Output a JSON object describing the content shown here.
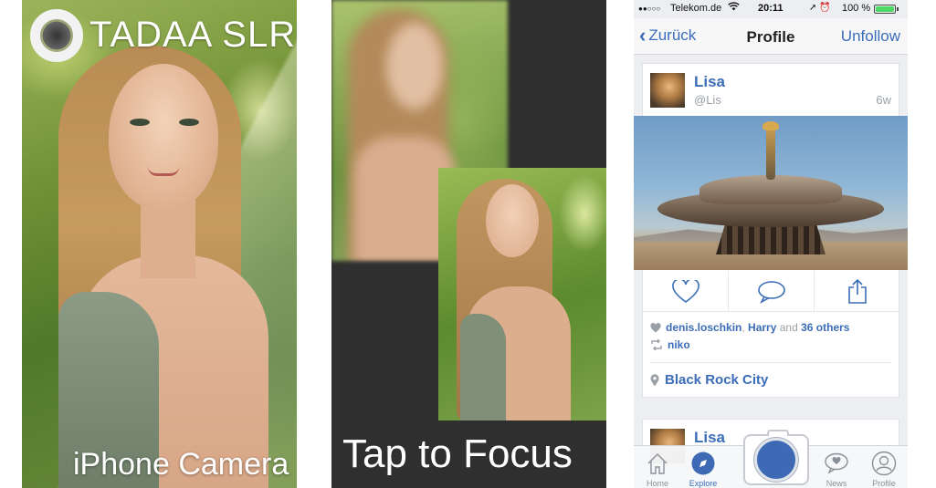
{
  "panel1": {
    "logo_text": "TADAA SLR",
    "caption": "iPhone Camera"
  },
  "panel2": {
    "caption": "Tap to Focus"
  },
  "phone": {
    "status": {
      "carrier": "Telekom.de",
      "time": "20:11",
      "battery_text": "100 %",
      "battery_level": 1.0,
      "battery_color": "#4cd964"
    },
    "nav": {
      "back_label": "Zurück",
      "title": "Profile",
      "right_label": "Unfollow"
    },
    "post": {
      "user_name": "Lisa",
      "handle": "@Lis",
      "time_ago": "6w",
      "likes_user1": "denis.loschkin",
      "likes_sep": ",",
      "likes_user2": "Harry",
      "likes_and": "and",
      "likes_others": "36 others",
      "repost_user": "niko",
      "location": "Black Rock City",
      "actions": [
        "heart-icon",
        "comment-icon",
        "share-icon"
      ]
    },
    "post2": {
      "user_name": "Lisa"
    },
    "tabs": [
      {
        "label": "Home",
        "icon": "home-icon"
      },
      {
        "label": "Explore",
        "icon": "explore-icon"
      },
      {
        "label": "News",
        "icon": "news-icon"
      },
      {
        "label": "Profile",
        "icon": "profile-icon"
      }
    ],
    "accent_color": "#3b6db8"
  }
}
